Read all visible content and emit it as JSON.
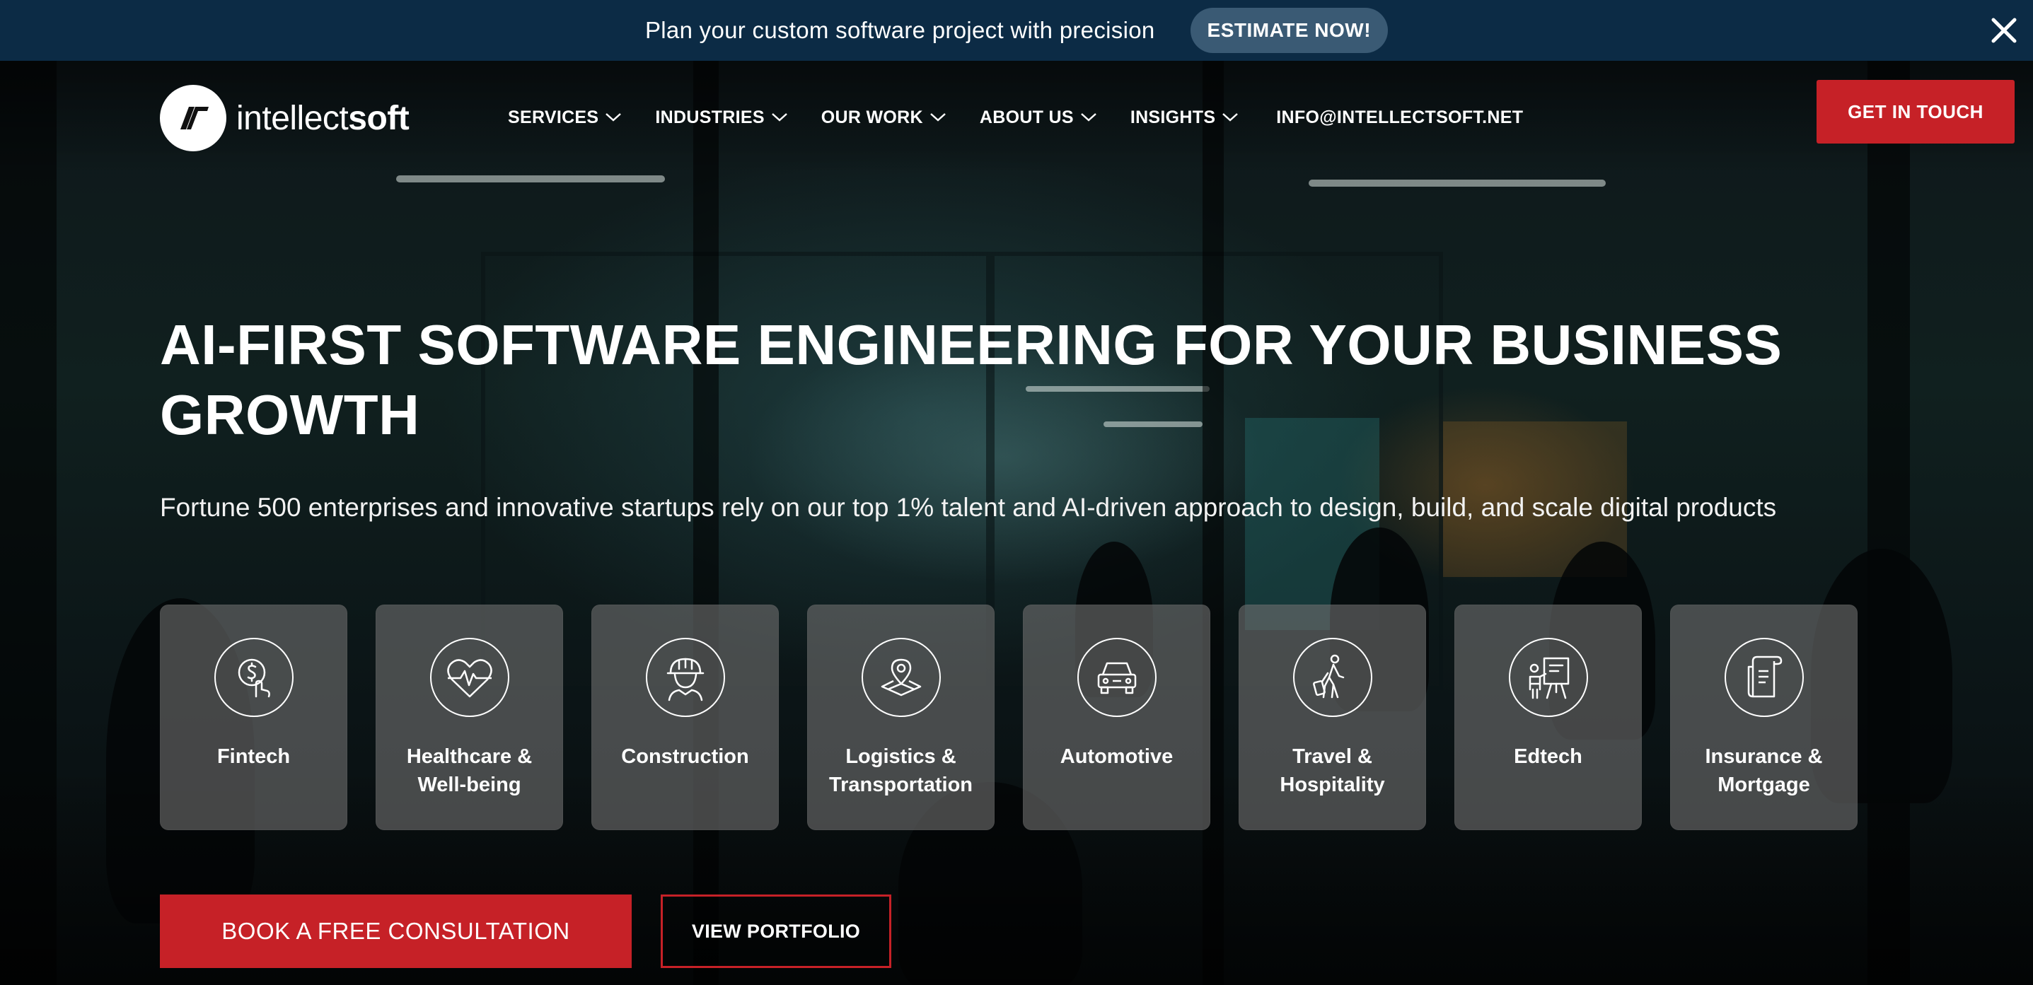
{
  "promo": {
    "text": "Plan your custom software project with precision",
    "button_label": "ESTIMATE NOW!",
    "close_icon": "close-icon"
  },
  "header": {
    "logo": {
      "text_light": "intellect",
      "text_bold": "soft",
      "icon": "intellectsoft-logo-icon"
    },
    "nav": [
      {
        "label": "SERVICES",
        "has_dropdown": true
      },
      {
        "label": "INDUSTRIES",
        "has_dropdown": true
      },
      {
        "label": "OUR WORK",
        "has_dropdown": true
      },
      {
        "label": "ABOUT US",
        "has_dropdown": true
      },
      {
        "label": "INSIGHTS",
        "has_dropdown": true
      },
      {
        "label": "INFO@INTELLECTSOFT.NET",
        "has_dropdown": false
      }
    ],
    "cta_label": "GET IN TOUCH"
  },
  "hero": {
    "title": "AI-FIRST SOFTWARE ENGINEERING FOR YOUR BUSINESS GROWTH",
    "subtitle": "Fortune 500 enterprises and innovative startups rely on our top 1% talent and AI-driven approach to design, build, and scale digital products",
    "industries": [
      {
        "label": "Fintech",
        "icon": "fintech-dollar-hand-icon"
      },
      {
        "label": "Healthcare & Well-being",
        "icon": "heart-pulse-icon"
      },
      {
        "label": "Construction",
        "icon": "construction-worker-icon"
      },
      {
        "label": "Logistics & Transportation",
        "icon": "map-pin-icon"
      },
      {
        "label": "Automotive",
        "icon": "car-icon"
      },
      {
        "label": "Travel & Hospitality",
        "icon": "traveler-luggage-icon"
      },
      {
        "label": "Edtech",
        "icon": "teacher-board-icon"
      },
      {
        "label": "Insurance & Mortgage",
        "icon": "document-icon"
      }
    ],
    "primary_button": "BOOK A FREE CONSULTATION",
    "secondary_button": "VIEW PORTFOLIO"
  },
  "colors": {
    "promo_bg": "#0c2b45",
    "promo_button_bg": "#3a5a74",
    "accent_red": "#c62127",
    "card_bg": "rgba(110,110,110,0.62)"
  }
}
